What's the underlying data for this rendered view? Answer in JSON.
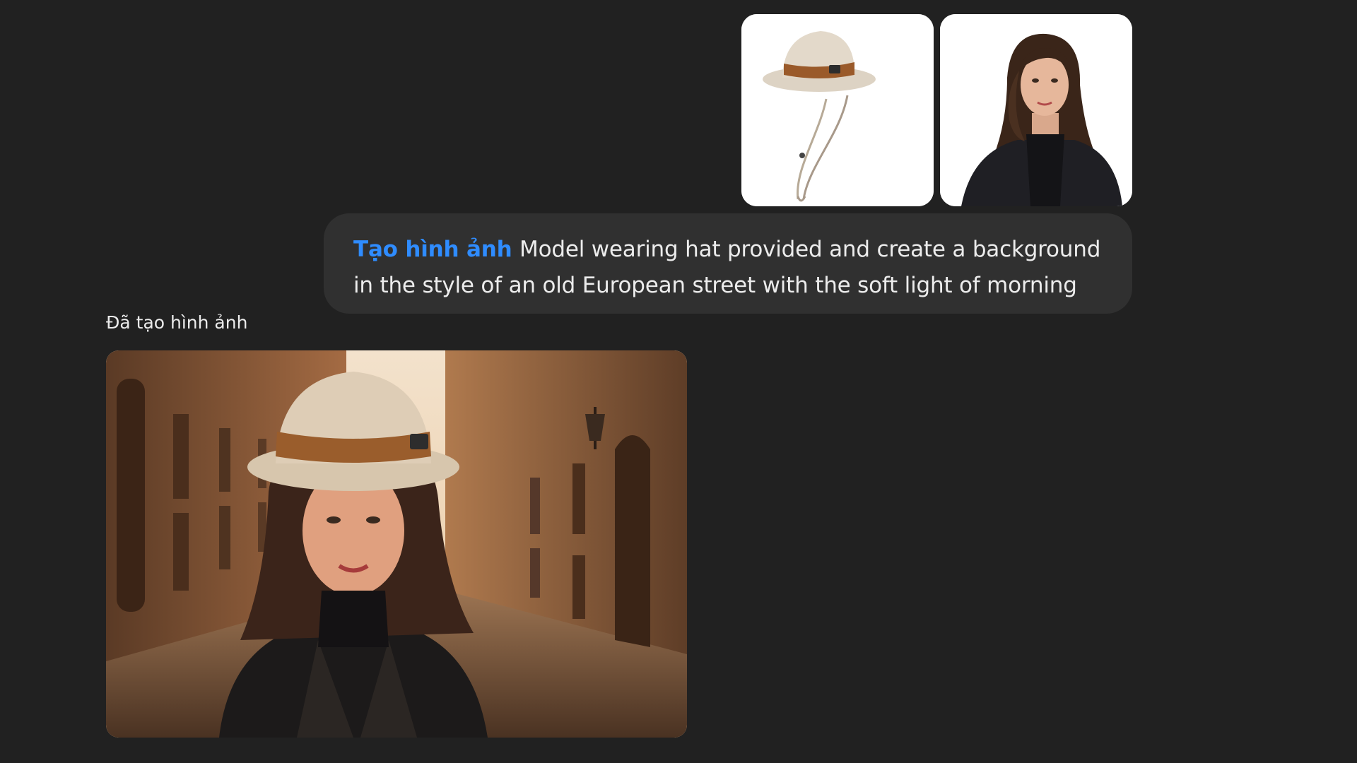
{
  "conversation": {
    "user_message": {
      "attachments": [
        {
          "name": "bucket-hat-photo"
        },
        {
          "name": "woman-model-photo"
        }
      ],
      "tool_tag": "Tạo hình ảnh",
      "text": "Model wearing hat provided and create a background in the style of an old European street with the soft light of morning"
    },
    "assistant_message": {
      "status": "Đã tạo hình ảnh",
      "image": {
        "name": "generated-image-woman-in-hat-on-european-street"
      }
    }
  },
  "colors": {
    "background": "#212121",
    "bubble": "#303030",
    "text": "#ececec",
    "tool_tag": "#2f8cff"
  }
}
